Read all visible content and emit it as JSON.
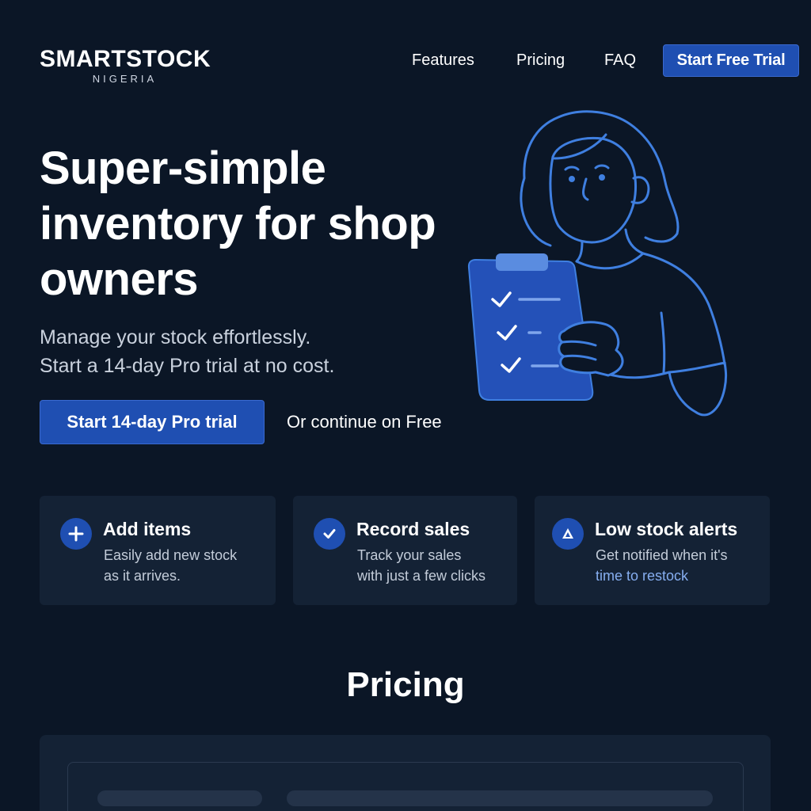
{
  "brand": {
    "name": "SMARTSTOCK",
    "tagline": "NIGERIA"
  },
  "nav": {
    "links": [
      {
        "label": "Features"
      },
      {
        "label": "Pricing"
      },
      {
        "label": "FAQ"
      }
    ],
    "cta_label": "Start Free Trial"
  },
  "hero": {
    "title": "Super-simple inventory for shop owners",
    "subtitle_lines": [
      "Manage your stock effortlessly.",
      "Start a 14-day Pro trial at no cost."
    ],
    "primary_cta": "Start 14-day Pro trial",
    "secondary_link": "Or continue on Free",
    "illustration_icon": "woman-holding-checklist-illustration"
  },
  "features": [
    {
      "icon": "plus-icon",
      "title": "Add items",
      "desc_lines": [
        "Easily add new stock",
        "as it arrives."
      ]
    },
    {
      "icon": "check-icon",
      "title": "Record sales",
      "desc_lines": [
        "Track your sales",
        "with just a few clicks"
      ]
    },
    {
      "icon": "alert-triangle-icon",
      "title": "Low stock alerts",
      "desc_lines": [
        "Get notified when it's",
        "time to restock"
      ]
    }
  ],
  "pricing": {
    "heading": "Pricing"
  },
  "colors": {
    "background": "#0b1626",
    "card": "#142235",
    "accent": "#1f4fb2",
    "accent_text": "#86aef0",
    "illustration_stroke": "#3f7fe0"
  }
}
